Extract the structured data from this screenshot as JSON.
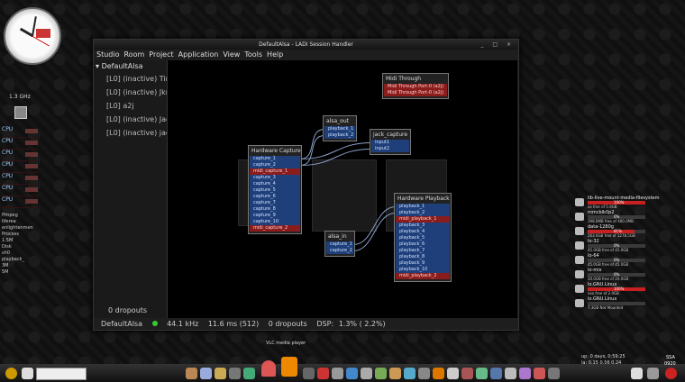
{
  "desktop": {
    "monitor_freq": "1.3 GHz",
    "cpu_labels": [
      "CPU",
      "CPU",
      "CPU",
      "CPU",
      "CPU",
      "CPU",
      "CPU"
    ],
    "misc_lines": [
      "ffmpeg",
      "liferea",
      "enlightenmen",
      "Process",
      "1.5M",
      "Disk",
      "sh0",
      "playback_",
      "3M",
      "5M"
    ],
    "drives": [
      {
        "name": "lib-live-mount-media-filesystem",
        "free": "xx free of 5.9GB",
        "percent": "100%",
        "fraction": 1.0
      },
      {
        "name": "mmcblk0p2",
        "free": "398.0MB free of 400.0MB",
        "percent": "0%",
        "fraction": 0.0
      },
      {
        "name": "data-1280g",
        "free": "263.0GB free of 1278.5GB",
        "percent": "81%",
        "fraction": 0.81
      },
      {
        "name": "lo-32",
        "free": "45.0GB free of 45.0GB",
        "percent": "0%",
        "fraction": 0.0
      },
      {
        "name": "lo-64",
        "free": "45.0GB free of 45.0GB",
        "percent": "0%",
        "fraction": 0.0
      },
      {
        "name": "lo-mix",
        "free": "20.0GB free of 20.0GB",
        "percent": "0%",
        "fraction": 0.0
      },
      {
        "name": "lo.GNU.Linux",
        "free": "xxx free of 2.0GB",
        "percent": "100%",
        "fraction": 1.0
      },
      {
        "name": "lo.GNU.Linux",
        "free": "7.3GB Not Mounted",
        "percent": "",
        "fraction": 0.0
      }
    ],
    "vlc_label": "VLC media player",
    "uptime_lines": [
      "up: 0 days, 0:59:25",
      "la: 0.15 0.56 0.24"
    ],
    "tray_labels": [
      "SSA",
      "0920"
    ]
  },
  "window": {
    "title": "DefaultAlsa - LADI Session Handler",
    "title_buttons": "_ □ ×",
    "menu": [
      "Studio",
      "Room",
      "Project",
      "Application",
      "View",
      "Tools",
      "Help"
    ],
    "studio_name": "DefaultAlsa",
    "projects": [
      "[L0] (inactive) Tin",
      "[L0] (inactive) Jkr",
      "[L0] a2j",
      "[L0] (inactive) Jac",
      "[L0] (inactive) jac"
    ],
    "panel_dropouts": "0 dropouts",
    "status": {
      "studio": "DefaultAlsa",
      "sample_rate": "44.1 kHz",
      "latency": "11.6 ms (512)",
      "dropouts": "0 dropouts",
      "dsp_label": "DSP:",
      "dsp_value": "1.3% (  2.2%)"
    }
  },
  "patchbay": {
    "midi_through": {
      "title": "Midi Through",
      "ports": [
        "Midi Through Port-0 (a2j)",
        "Midi Through Port-0 (a2j)"
      ]
    },
    "alsa_out": {
      "title": "alsa_out",
      "ports": [
        "playback_1",
        "playback_2"
      ]
    },
    "jack_capture": {
      "title": "jack_capture",
      "ports": [
        "input1",
        "input2"
      ]
    },
    "hw_capture": {
      "title": "Hardware Capture",
      "ports": [
        {
          "label": "capture_1",
          "kind": "audio"
        },
        {
          "label": "capture_2",
          "kind": "audio"
        },
        {
          "label": "midi_capture_1",
          "kind": "midi"
        },
        {
          "label": "capture_3",
          "kind": "audio"
        },
        {
          "label": "capture_4",
          "kind": "audio"
        },
        {
          "label": "capture_5",
          "kind": "audio"
        },
        {
          "label": "capture_6",
          "kind": "audio"
        },
        {
          "label": "capture_7",
          "kind": "audio"
        },
        {
          "label": "capture_8",
          "kind": "audio"
        },
        {
          "label": "capture_9",
          "kind": "audio"
        },
        {
          "label": "capture_10",
          "kind": "audio"
        },
        {
          "label": "midi_capture_2",
          "kind": "midi"
        }
      ]
    },
    "alsa_in": {
      "title": "alsa_in",
      "ports": [
        "capture_1",
        "capture_2"
      ]
    },
    "hw_playback": {
      "title": "Hardware Playback",
      "ports": [
        {
          "label": "playback_1",
          "kind": "audio"
        },
        {
          "label": "playback_2",
          "kind": "audio"
        },
        {
          "label": "midi_playback_1",
          "kind": "midi"
        },
        {
          "label": "playback_3",
          "kind": "audio"
        },
        {
          "label": "playback_4",
          "kind": "audio"
        },
        {
          "label": "playback_5",
          "kind": "audio"
        },
        {
          "label": "playback_6",
          "kind": "audio"
        },
        {
          "label": "playback_7",
          "kind": "audio"
        },
        {
          "label": "playback_8",
          "kind": "audio"
        },
        {
          "label": "playback_9",
          "kind": "audio"
        },
        {
          "label": "playback_10",
          "kind": "audio"
        },
        {
          "label": "midi_playback_2",
          "kind": "midi"
        }
      ]
    }
  },
  "colors": {
    "audio_port": "#1f3f7a",
    "midi_port": "#8a1c1c",
    "status_ok": "#33cc33",
    "usage_bar": "#c62020"
  }
}
